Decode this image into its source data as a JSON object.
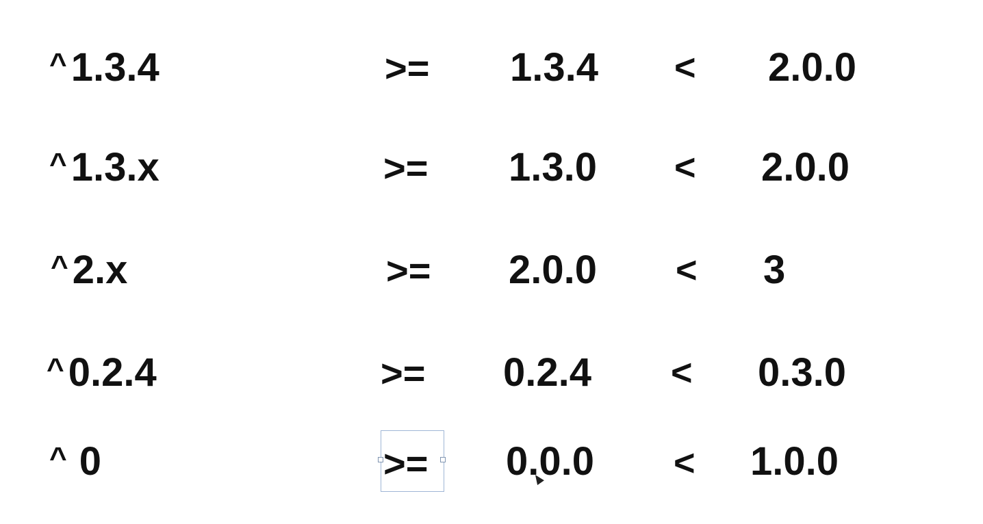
{
  "rows": [
    {
      "caret": "^",
      "spec": "1.3.4",
      "gte": ">=",
      "min": "1.3.4",
      "lt": "<",
      "max": "2.0.0"
    },
    {
      "caret": "^",
      "spec": "1.3.x",
      "gte": ">=",
      "min": "1.3.0",
      "lt": "<",
      "max": "2.0.0"
    },
    {
      "caret": "^",
      "spec": "2.x",
      "gte": ">=",
      "min": "2.0.0",
      "lt": "<",
      "max": "3"
    },
    {
      "caret": "^",
      "spec": "0.2.4",
      "gte": ">=",
      "min": "0.2.4",
      "lt": "<",
      "max": "0.3.0"
    },
    {
      "caret": "^",
      "spec": "0",
      "gte": ">=",
      "min": "0.0.0",
      "lt": "<",
      "max": "1.0.0"
    }
  ]
}
